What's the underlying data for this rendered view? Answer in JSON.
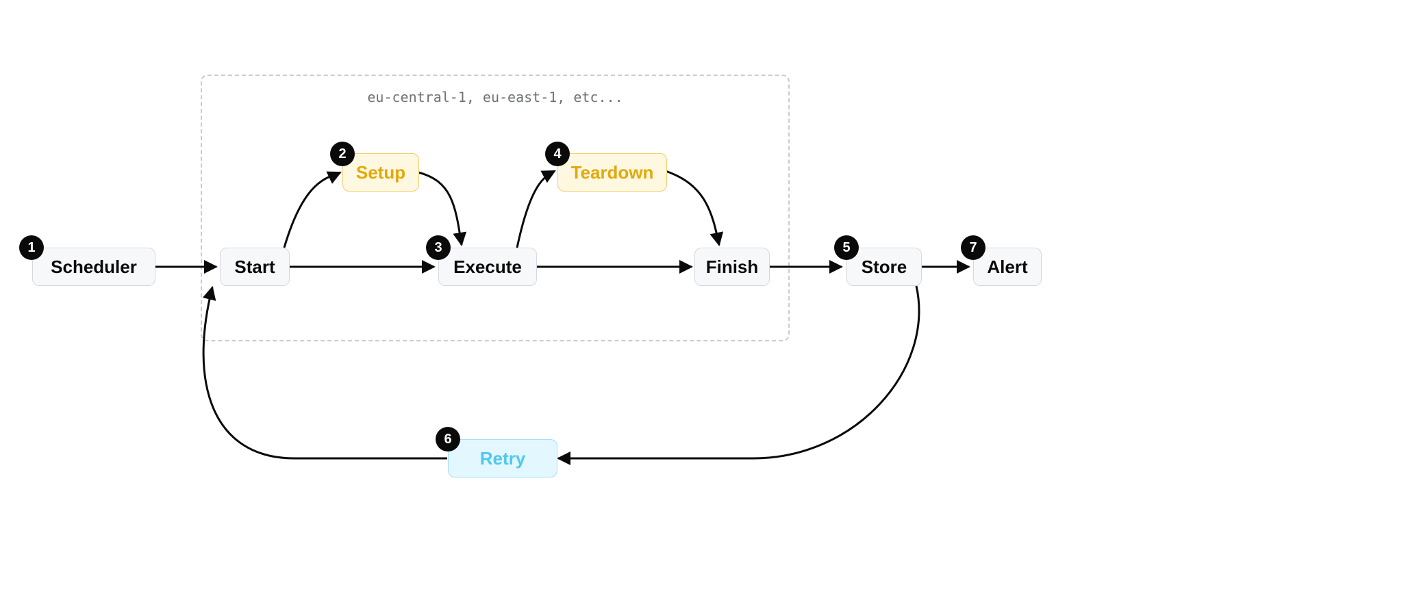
{
  "region": {
    "label": "eu-central-1, eu-east-1, etc..."
  },
  "nodes": {
    "scheduler": {
      "label": "Scheduler",
      "badge": "1"
    },
    "start": {
      "label": "Start"
    },
    "setup": {
      "label": "Setup",
      "badge": "2"
    },
    "execute": {
      "label": "Execute",
      "badge": "3"
    },
    "teardown": {
      "label": "Teardown",
      "badge": "4"
    },
    "finish": {
      "label": "Finish"
    },
    "store": {
      "label": "Store",
      "badge": "5"
    },
    "retry": {
      "label": "Retry",
      "badge": "6"
    },
    "alert": {
      "label": "Alert",
      "badge": "7"
    }
  },
  "colors": {
    "arrow": "#0a0a0a",
    "dash": "#c9cbd4"
  }
}
